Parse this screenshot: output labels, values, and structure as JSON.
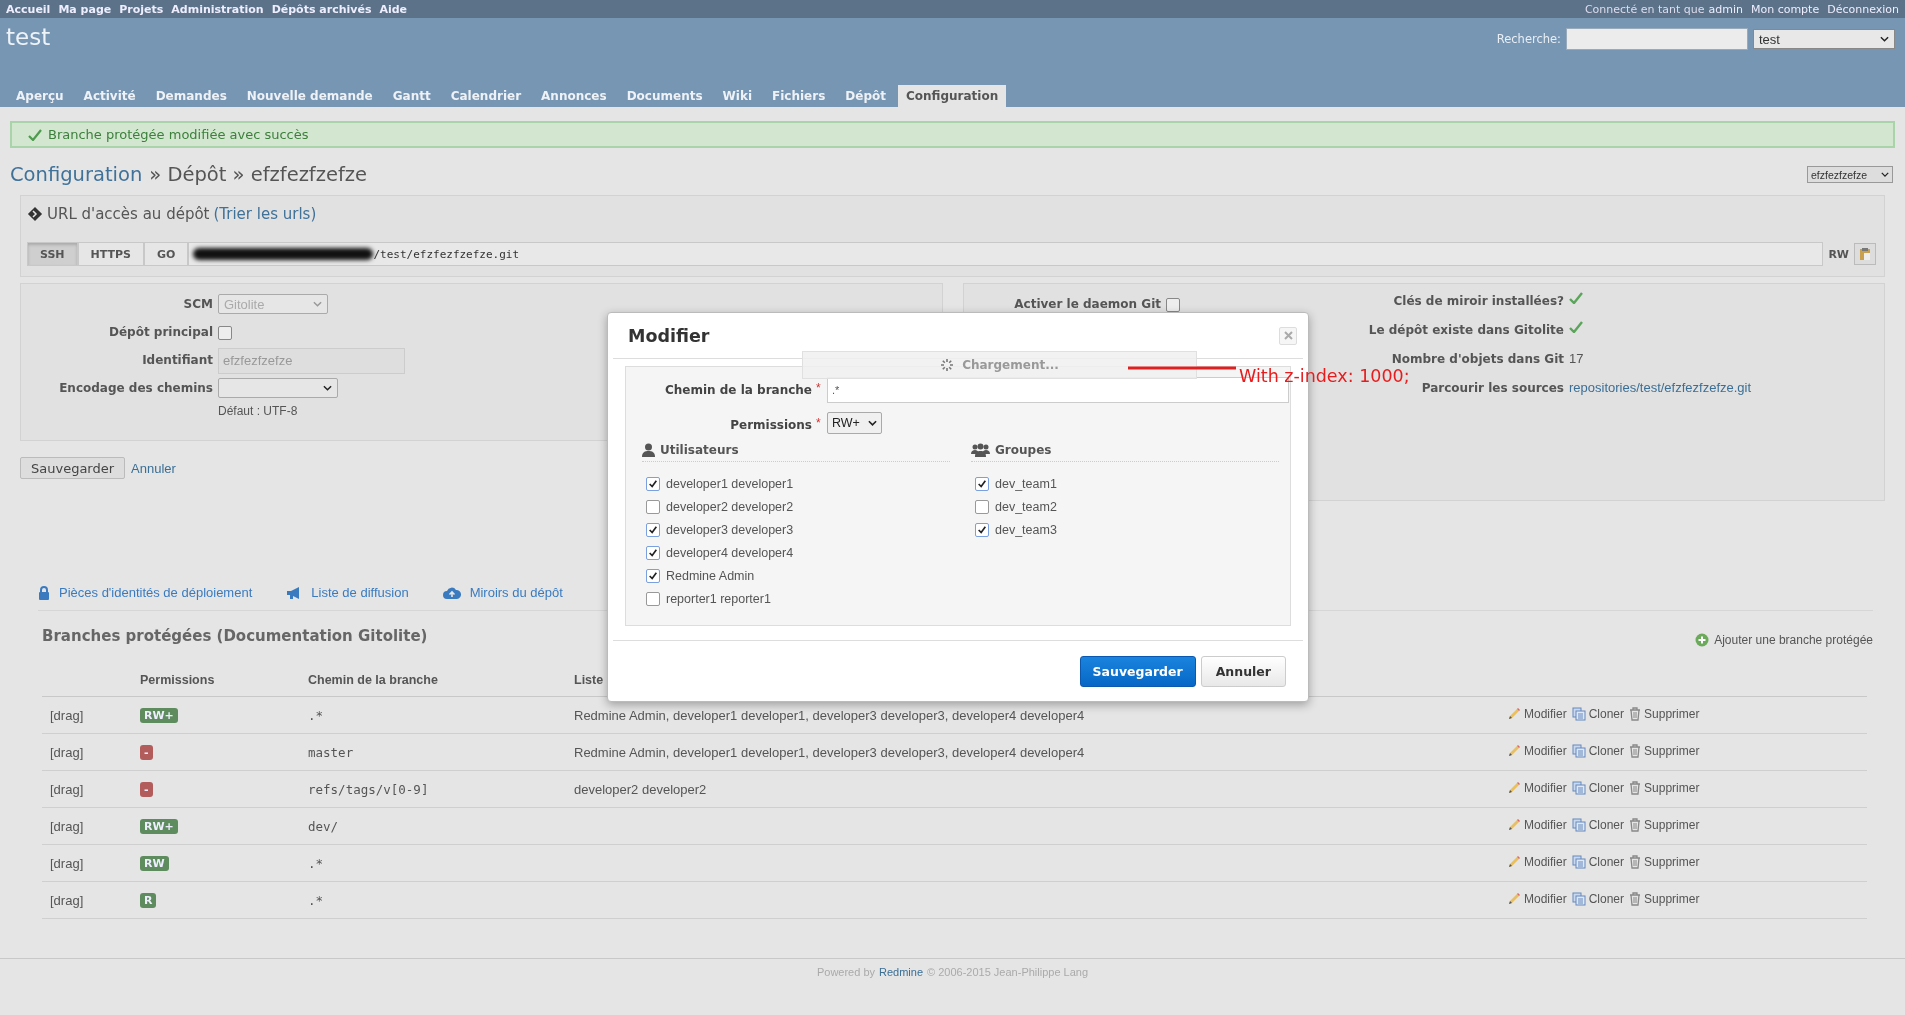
{
  "top_menu": {
    "left": [
      "Accueil",
      "Ma page",
      "Projets",
      "Administration",
      "Dépôts archivés",
      "Aide"
    ],
    "logged_in": "Connecté en tant que",
    "user": "admin",
    "right": [
      "Mon compte",
      "Déconnexion"
    ]
  },
  "project_title": "test",
  "search": {
    "label": "Recherche:"
  },
  "project_select": "test",
  "tabs": [
    {
      "label": "Aperçu",
      "selected": false
    },
    {
      "label": "Activité",
      "selected": false
    },
    {
      "label": "Demandes",
      "selected": false
    },
    {
      "label": "Nouvelle demande",
      "selected": false
    },
    {
      "label": "Gantt",
      "selected": false
    },
    {
      "label": "Calendrier",
      "selected": false
    },
    {
      "label": "Annonces",
      "selected": false
    },
    {
      "label": "Documents",
      "selected": false
    },
    {
      "label": "Wiki",
      "selected": false
    },
    {
      "label": "Fichiers",
      "selected": false
    },
    {
      "label": "Dépôt",
      "selected": false
    },
    {
      "label": "Configuration",
      "selected": true
    }
  ],
  "flash": "Branche protégée modifiée avec succès",
  "breadcrumb": {
    "link": "Configuration",
    "rest": "» Dépôt » efzfezfzefze"
  },
  "repo_select": "efzfezfzefze",
  "url_box": {
    "title": "URL d'accès au dépôt",
    "sort_link": "(Trier les urls)",
    "protocols": [
      {
        "label": "SSH",
        "selected": true
      },
      {
        "label": "HTTPS",
        "selected": false
      },
      {
        "label": "GO",
        "selected": false
      }
    ],
    "url": "/test/efzfezfzefze.git",
    "access": "RW"
  },
  "settings": [
    {
      "kind": "select",
      "label": "SCM",
      "value": "Gitolite",
      "disabled": true
    },
    {
      "kind": "checkbox",
      "label": "Dépôt principal",
      "checked": false
    },
    {
      "kind": "text",
      "label": "Identifiant",
      "value": "efzfezfzefze",
      "disabled": true
    },
    {
      "kind": "select",
      "label": "Encodage des chemins",
      "hint": "Défaut : UTF-8"
    }
  ],
  "git_daemon": {
    "label": "Activer le daemon Git",
    "checked": false
  },
  "info": [
    {
      "kind": "check",
      "label": "Clés de miroir installées?"
    },
    {
      "kind": "check",
      "label": "Le dépôt existe dans Gitolite"
    },
    {
      "kind": "text",
      "label": "Nombre d'objets dans Git",
      "value": "17"
    },
    {
      "kind": "link",
      "label": "Parcourir les sources",
      "value": "repositories/test/efzfezfzefze.git"
    }
  ],
  "form_buttons": {
    "save": "Sauvegarder",
    "cancel": "Annuler"
  },
  "sub_tabs": [
    "Pièces d'identités de déploiement",
    "Liste de diffusion",
    "Miroirs du dépôt"
  ],
  "protected_branches": {
    "title": "Branches protégées (Documentation Gitolite)",
    "add": "Ajouter une branche protégée",
    "columns": [
      "Permissions",
      "Chemin de la branche",
      "Liste"
    ],
    "rows": [
      {
        "handle": "[drag]",
        "permission": "RW+",
        "color": "#5e8c5e",
        "path": ".*",
        "users": "Redmine Admin, developer1 developer1, developer3 developer3, developer4 developer4",
        "actions": [
          "Modifier",
          "Cloner",
          "Supprimer"
        ]
      },
      {
        "handle": "[drag]",
        "permission": "-",
        "color": "#b35c5c",
        "path": "master",
        "users": "Redmine Admin, developer1 developer1, developer3 developer3, developer4 developer4",
        "actions": [
          "Modifier",
          "Cloner",
          "Supprimer"
        ]
      },
      {
        "handle": "[drag]",
        "permission": "-",
        "color": "#b35c5c",
        "path": "refs/tags/v[0-9]",
        "users": "developer2 developer2",
        "actions": [
          "Modifier",
          "Cloner",
          "Supprimer"
        ]
      },
      {
        "handle": "[drag]",
        "permission": "RW+",
        "color": "#5e8c5e",
        "path": "dev/",
        "actions": [
          "Modifier",
          "Cloner",
          "Supprimer"
        ]
      },
      {
        "handle": "[drag]",
        "permission": "RW",
        "color": "#5e8c5e",
        "path": ".*",
        "actions": [
          "Modifier",
          "Cloner",
          "Supprimer"
        ]
      },
      {
        "handle": "[drag]",
        "permission": "R",
        "color": "#5e8c5e",
        "path": ".*",
        "actions": [
          "Modifier",
          "Cloner",
          "Supprimer"
        ]
      }
    ]
  },
  "modal": {
    "title": "Modifier",
    "loading": "Chargement...",
    "path_label": "Chemin de la branche",
    "path_required": "*",
    "path_value": ".*",
    "permissions_label": "Permissions",
    "permissions_required": "*",
    "permissions_value": "RW+",
    "users_title": "Utilisateurs",
    "groups_title": "Groupes",
    "users": [
      {
        "label": "developer1 developer1",
        "checked": true
      },
      {
        "label": "developer2 developer2",
        "checked": false
      },
      {
        "label": "developer3 developer3",
        "checked": true
      },
      {
        "label": "developer4 developer4",
        "checked": true
      },
      {
        "label": "Redmine Admin",
        "checked": true
      },
      {
        "label": "reporter1 reporter1",
        "checked": false
      }
    ],
    "groups": [
      {
        "label": "dev_team1",
        "checked": true
      },
      {
        "label": "dev_team2",
        "checked": false
      },
      {
        "label": "dev_team3",
        "checked": true
      }
    ],
    "save": "Sauvegarder",
    "cancel": "Annuler"
  },
  "annotation": "With z-index: 1000;",
  "footer": {
    "prefix": "Powered by",
    "link": "Redmine",
    "suffix": "© 2006-2015 Jean-Philippe Lang"
  }
}
